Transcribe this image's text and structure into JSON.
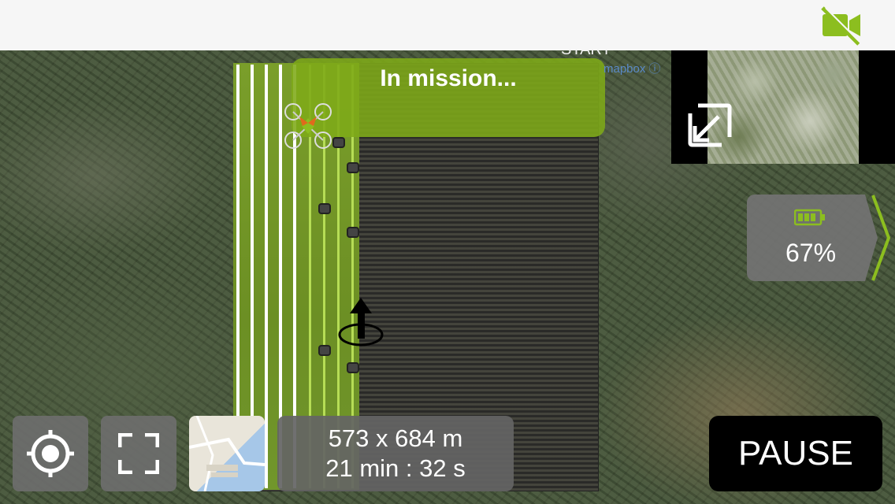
{
  "topbar": {
    "camera_icon": "video-off-icon",
    "accent": "#8cbe1f"
  },
  "map": {
    "start_label": "START",
    "attribution": "mapbox",
    "attribution_icon": "info-icon"
  },
  "mission": {
    "status_text": "In mission...",
    "banner_color": "#7eaa18"
  },
  "battery": {
    "percent_label": "67%",
    "level": 0.67,
    "icon": "battery-icon",
    "color": "#8cbe1f"
  },
  "preview": {
    "expand_icon": "collapse-arrow-icon"
  },
  "controls": {
    "locate_icon": "crosshair-icon",
    "fullscreen_icon": "fullscreen-icon",
    "map_style_thumb": "map-thumbnail"
  },
  "info": {
    "area": "573 x 684 m",
    "duration": "21 min : 32 s"
  },
  "pause_button": {
    "label": "PAUSE"
  }
}
